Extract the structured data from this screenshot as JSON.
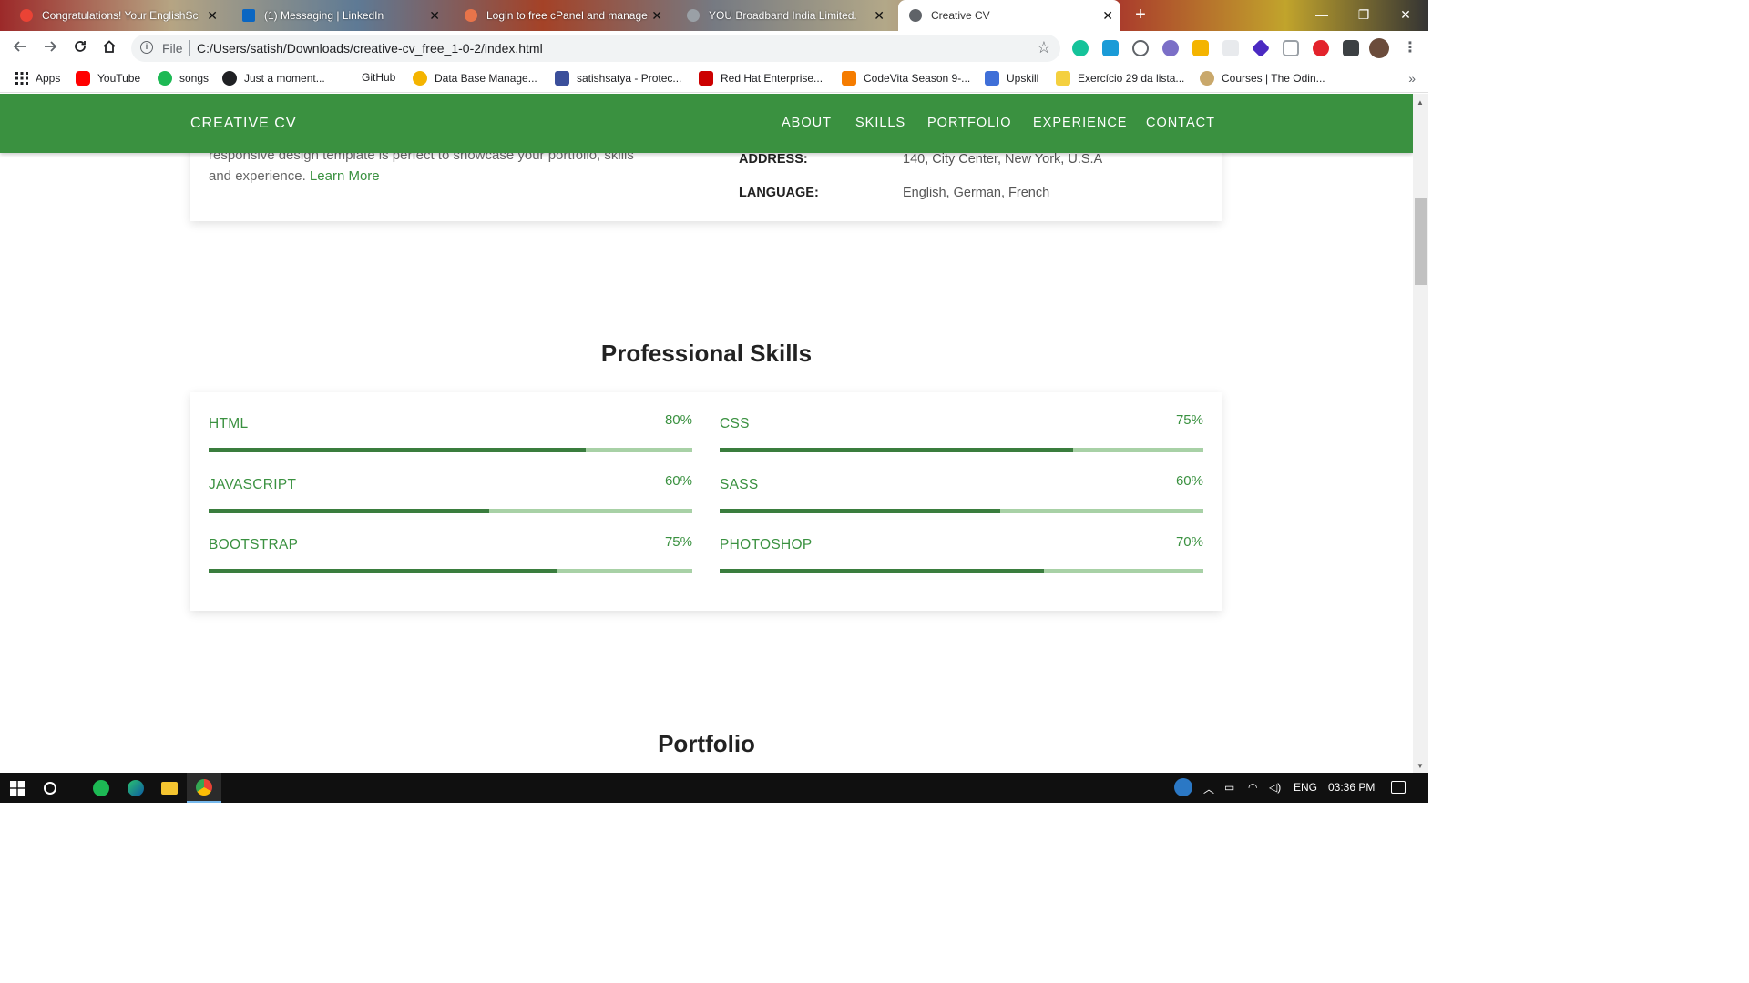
{
  "browser": {
    "tabs": [
      {
        "title": "Congratulations! Your EnglishSc",
        "favicon_color": "#ea4335"
      },
      {
        "title": "(1) Messaging | LinkedIn",
        "favicon_color": "#0a66c2"
      },
      {
        "title": "Login to free cPanel and manage",
        "favicon_color": "#e8744a"
      },
      {
        "title": "YOU Broadband India Limited.",
        "favicon_color": "#9aa0a6"
      },
      {
        "title": "Creative CV",
        "favicon_color": "#5f6368",
        "active": true
      }
    ],
    "close_glyph": "✕",
    "newtab_glyph": "+",
    "window_controls": {
      "minimize": "—",
      "restore": "❐",
      "close": "✕"
    },
    "scheme": "File",
    "url": "C:/Users/satish/Downloads/creative-cv_free_1-0-2/index.html",
    "bookmarks": [
      {
        "label": "Apps",
        "icon": "apps-grid-icon",
        "color": "#5f6368"
      },
      {
        "label": "YouTube",
        "icon": "youtube-icon",
        "color": "#ff0000"
      },
      {
        "label": "songs",
        "icon": "songs-icon",
        "color": "#1db954"
      },
      {
        "label": "Just a moment...",
        "icon": "globe-icon",
        "color": "#202124"
      },
      {
        "label": "GitHub",
        "icon": "",
        "color": "#ffffff"
      },
      {
        "label": "Data Base Manage...",
        "icon": "database-icon",
        "color": "#f4b400"
      },
      {
        "label": "satishsatya - Protec...",
        "icon": "pt-icon",
        "color": "#3b4f9b"
      },
      {
        "label": "Red Hat Enterprise...",
        "icon": "redhat-icon",
        "color": "#cc0000"
      },
      {
        "label": "CodeVita Season 9-...",
        "icon": "codevita-icon",
        "color": "#f57c00"
      },
      {
        "label": "Upskill",
        "icon": "upskill-icon",
        "color": "#3f6fd8"
      },
      {
        "label": "Exercício 29 da lista...",
        "icon": "pencil-icon",
        "color": "#f4d03f"
      },
      {
        "label": "Courses | The Odin...",
        "icon": "odin-icon",
        "color": "#c9a86b"
      }
    ],
    "more_glyph": "»"
  },
  "site": {
    "brand": "CREATIVE CV",
    "nav": [
      "ABOUT",
      "SKILLS",
      "PORTFOLIO",
      "EXPERIENCE",
      "CONTACT"
    ],
    "about": {
      "text_line1": "responsive design template is perfect to showcase your portfolio, skills",
      "text_line2": "and experience.",
      "learn_more": "Learn More",
      "rows": [
        {
          "label": "ADDRESS:",
          "value": "140, City Center, New York, U.S.A"
        },
        {
          "label": "LANGUAGE:",
          "value": "English, German, French"
        }
      ]
    },
    "skills_title": "Professional Skills",
    "skills": [
      {
        "name": "HTML",
        "percent_label": "80%",
        "level": 0.78
      },
      {
        "name": "CSS",
        "percent_label": "75%",
        "level": 0.73
      },
      {
        "name": "JAVASCRIPT",
        "percent_label": "60%",
        "level": 0.58
      },
      {
        "name": "SASS",
        "percent_label": "60%",
        "level": 0.58
      },
      {
        "name": "BOOTSTRAP",
        "percent_label": "75%",
        "level": 0.72
      },
      {
        "name": "PHOTOSHOP",
        "percent_label": "70%",
        "level": 0.67
      }
    ],
    "portfolio_title": "Portfolio"
  },
  "taskbar": {
    "tray": {
      "lang": "ENG",
      "time": "03:36 PM"
    }
  }
}
